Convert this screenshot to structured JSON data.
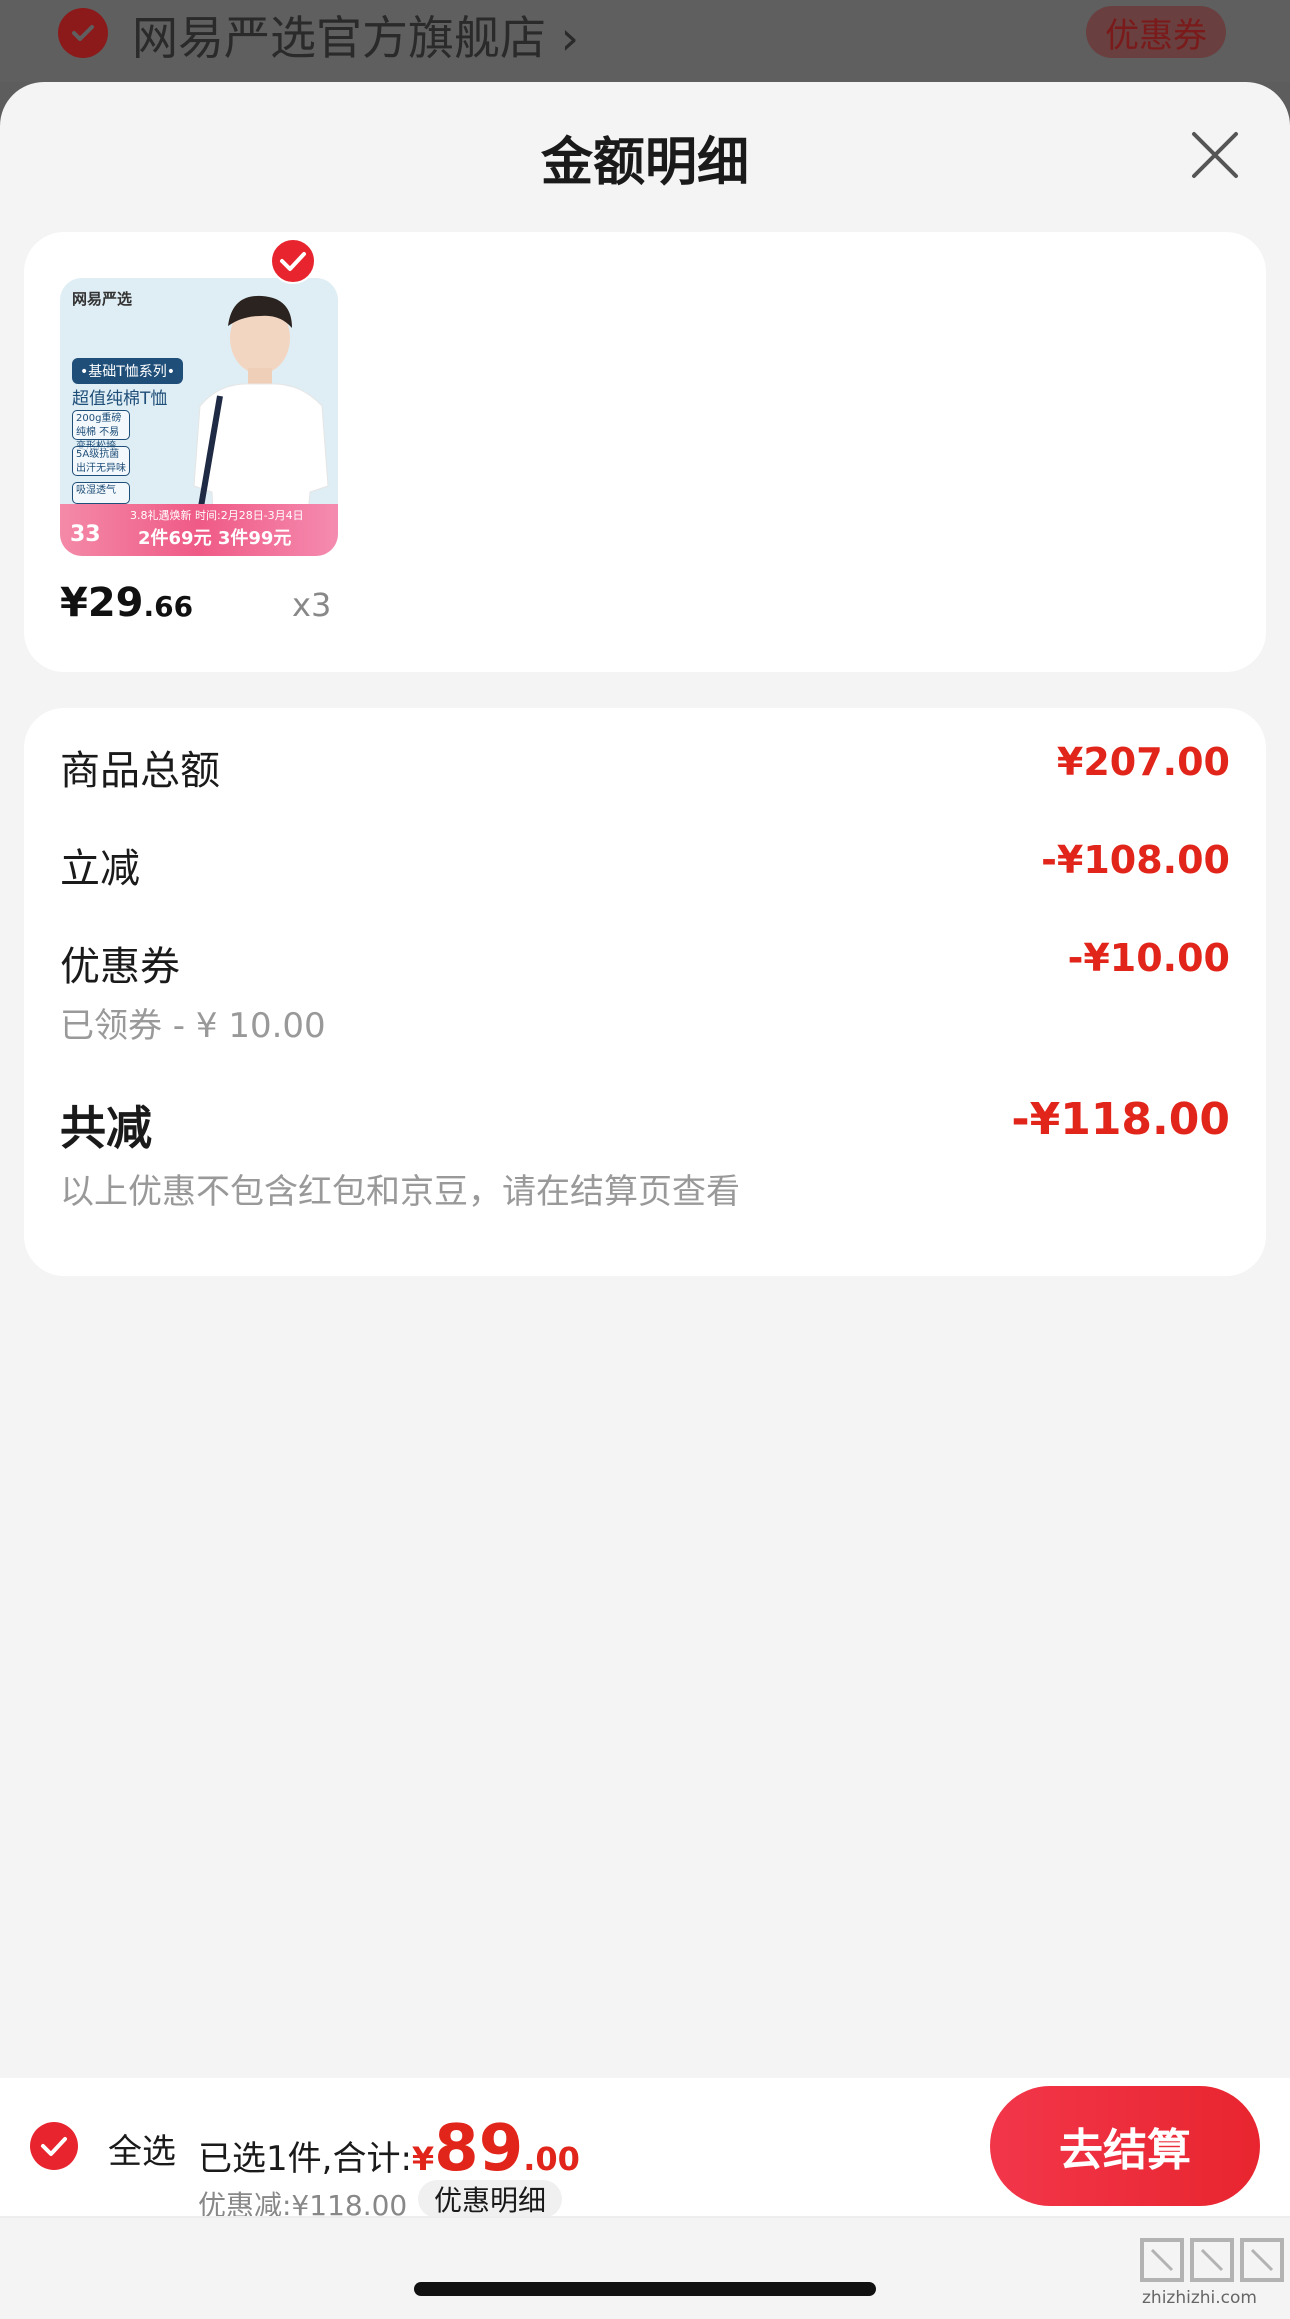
{
  "background_store": {
    "name": "网易严选官方旗舰店",
    "chevron": "›",
    "coupon_label": "优惠券"
  },
  "sheet": {
    "title": "金额明细",
    "close_icon": "close-icon"
  },
  "product": {
    "thumb_brand": "网易严选",
    "thumb_series": "•基础T恤系列•",
    "thumb_title": "超值纯棉T恤",
    "thumb_chips": [
      "200g重磅纯棉 不易变形松垮",
      "5A级抗菌 出汗无异味",
      "吸湿透气"
    ],
    "thumb_banner_top": "3.8礼遇焕新  时间:2月28日-3月4日",
    "thumb_banner_price": "2件69元 3件99元",
    "thumb_banner_num": "33",
    "price_int": "¥29",
    "price_dec": ".66",
    "quantity": "x3",
    "selected": true
  },
  "summary": {
    "goods_total_label": "商品总额",
    "goods_total_value": "¥207.00",
    "instant_discount_label": "立减",
    "instant_discount_value": "-¥108.00",
    "coupon_label": "优惠券",
    "coupon_value": "-¥10.00",
    "coupon_sub": "已领券 - ¥ 10.00",
    "total_discount_label": "共减",
    "total_discount_value": "-¥118.00",
    "total_discount_note": "以上优惠不包含红包和京豆，请在结算页查看"
  },
  "bottom_bar": {
    "select_all_label": "全选",
    "selected_text": "已选1件,合计:",
    "currency": "¥",
    "total_int": "89",
    "total_dec": ".00",
    "discount_text": "优惠减:¥118.00",
    "detail_chip": "优惠明细",
    "checkout_label": "去结算"
  },
  "watermark": {
    "text": "zhizhizhi.com"
  },
  "colors": {
    "accent_red": "#e1251b",
    "checkout_gradient_start": "#f2364a",
    "checkout_gradient_end": "#e8252f",
    "sheet_bg": "#f4f4f4",
    "card_bg": "#ffffff"
  }
}
